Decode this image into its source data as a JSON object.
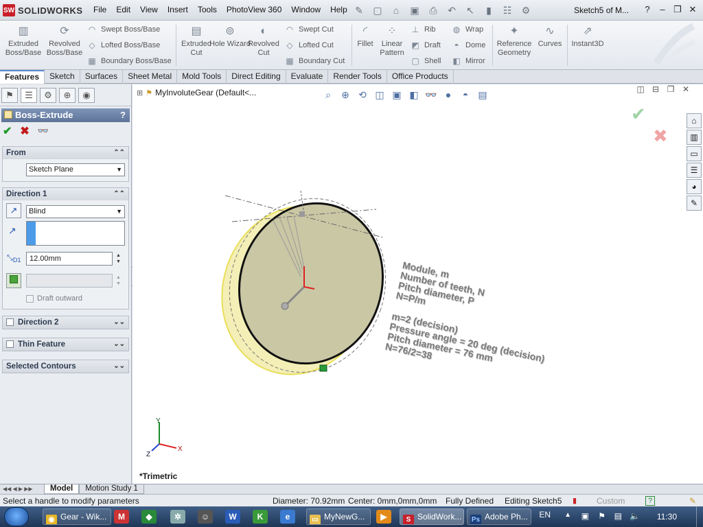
{
  "app": {
    "logo_text": "SOLIDWORKS",
    "logo_mark": "SW",
    "document_title": "Sketch5 of M..."
  },
  "menu": [
    "File",
    "Edit",
    "View",
    "Insert",
    "Tools",
    "PhotoView 360",
    "Window",
    "Help"
  ],
  "command_manager": {
    "extruded_boss": "Extruded Boss/Base",
    "revolved_boss": "Revolved Boss/Base",
    "swept_boss": "Swept Boss/Base",
    "lofted_boss": "Lofted Boss/Base",
    "boundary_boss": "Boundary Boss/Base",
    "extruded_cut": "Extruded Cut",
    "hole_wizard": "Hole Wizard",
    "revolved_cut": "Revolved Cut",
    "swept_cut": "Swept Cut",
    "lofted_cut": "Lofted Cut",
    "boundary_cut": "Boundary Cut",
    "fillet": "Fillet",
    "linear_pattern": "Linear Pattern",
    "rib": "Rib",
    "draft": "Draft",
    "shell": "Shell",
    "wrap": "Wrap",
    "dome": "Dome",
    "mirror": "Mirror",
    "reference_geometry": "Reference Geometry",
    "curves": "Curves",
    "instant3d": "Instant3D"
  },
  "tabs": [
    "Features",
    "Sketch",
    "Surfaces",
    "Sheet Metal",
    "Mold Tools",
    "Direct Editing",
    "Evaluate",
    "Render Tools",
    "Office Products"
  ],
  "property_manager": {
    "title": "Boss-Extrude",
    "help": "?",
    "from": {
      "header": "From",
      "value": "Sketch Plane"
    },
    "direction1": {
      "header": "Direction 1",
      "end_condition": "Blind",
      "depth": "12.00mm",
      "draft_outward": "Draft outward",
      "depth_tag": "D1"
    },
    "direction2": {
      "header": "Direction 2"
    },
    "thin_feature": {
      "header": "Thin Feature"
    },
    "selected_contours": {
      "header": "Selected Contours"
    }
  },
  "graphics": {
    "tree_label": "MyInvoluteGear  (Default<...",
    "view_name": "*Trimetric",
    "axis_labels": {
      "x": "X",
      "y": "Y",
      "z": "Z"
    },
    "notes_block1": [
      "Module, m",
      "Number of teeth, N",
      "Pitch diameter, P",
      "N=P/m"
    ],
    "notes_block2": [
      "m=2 (decision)",
      "Pressure angle = 20 deg (decision)",
      "Pitch diameter = 76 mm",
      "N=76/2=38"
    ]
  },
  "bottom_tabs": [
    "Model",
    "Motion Study 1"
  ],
  "status": {
    "message": "Select a handle to modify parameters",
    "diameter": "Diameter: 70.92mm",
    "center": "Center: 0mm,0mm,0mm",
    "state": "Fully Defined",
    "editing": "Editing Sketch5",
    "units": "Custom",
    "help": "?"
  },
  "taskbar": {
    "buttons": [
      "Gear - Wik...",
      "MyNewG...",
      "SolidWork...",
      "Adobe Ph..."
    ],
    "language": "EN",
    "clock": "11:30"
  },
  "colors": {
    "accent_red": "#c8202a",
    "panel_header": "#5d7398",
    "gear_face": "#c9c7a4",
    "gear_rim": "#f4efb6"
  }
}
